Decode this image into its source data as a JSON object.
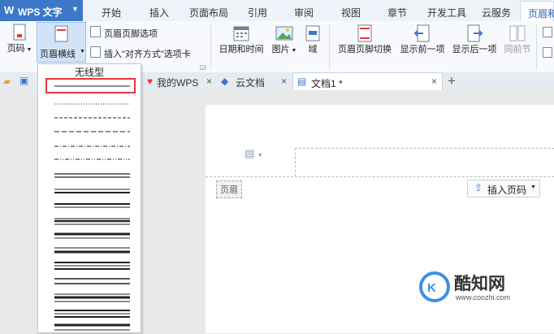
{
  "app": {
    "name": "WPS 文字",
    "logo": "W"
  },
  "menu": {
    "tabs": [
      "开始",
      "插入",
      "页面布局",
      "引用",
      "审阅",
      "视图",
      "章节",
      "开发工具",
      "云服务"
    ],
    "active_tab": "页眉和"
  },
  "ribbon": {
    "page_number": "页码",
    "header_line": "页眉横线",
    "header_footer_options": "页眉页脚选项",
    "insert_align_tab": "插入\"对齐方式\"选项卡",
    "date_time": "日期和时间",
    "picture": "图片",
    "field": "域",
    "switch_header_footer": "页眉页脚切换",
    "show_prev": "显示前一项",
    "show_next": "显示后一项",
    "same_as_prev": "同前节"
  },
  "doc_tabs": {
    "mywps": "我的WPS",
    "cloud": "云文档",
    "doc1": "文档1 *",
    "close": "×",
    "new": "+"
  },
  "dropdown": {
    "title": "无线型",
    "line_styles": [
      "single",
      "dotted",
      "dashed",
      "dash-dot",
      "dash-dot-dot",
      "double",
      "thick-thin",
      "thin-thick",
      "triple",
      "thick",
      "thin-thick-thin",
      "multi"
    ]
  },
  "document": {
    "header_label": "页眉",
    "insert_page_number": "插入页码"
  },
  "watermark": {
    "brand": "酷知网",
    "url": "www.coozhi.com"
  },
  "colors": {
    "accent": "#3d78c8",
    "selection": "#e0393e"
  }
}
